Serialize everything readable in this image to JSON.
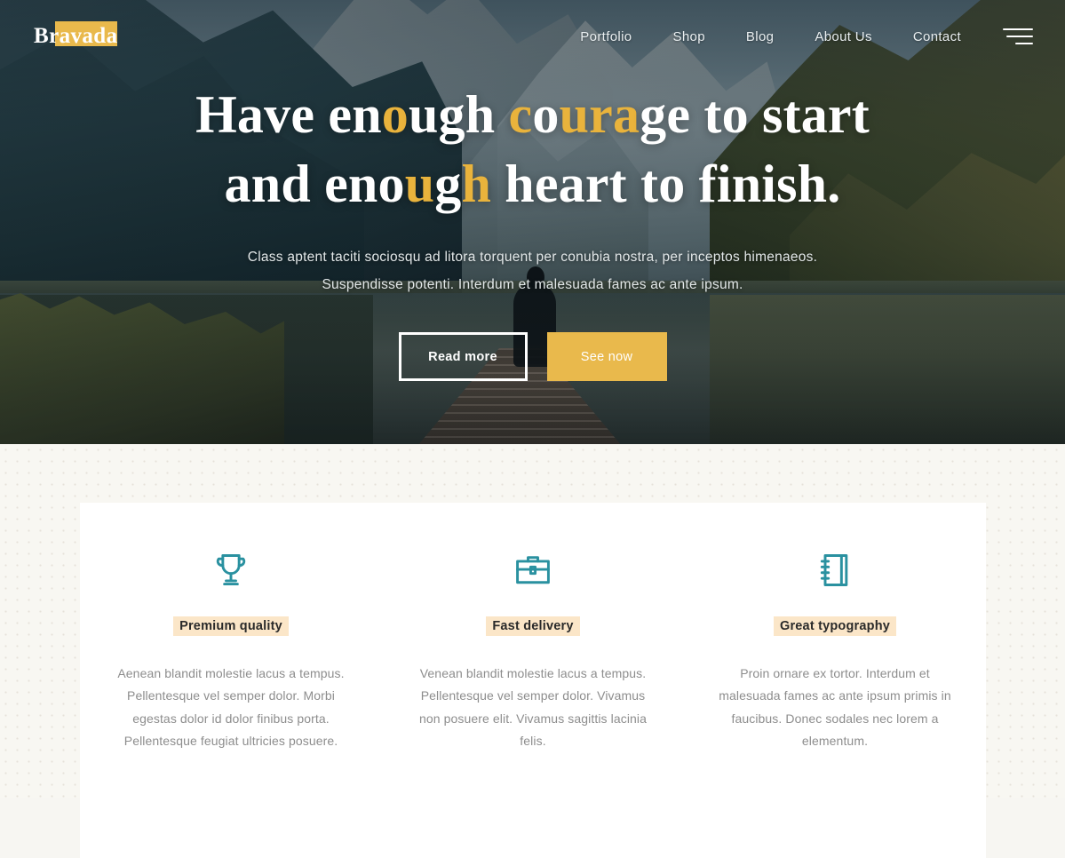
{
  "brand": {
    "name": "Bravada",
    "highlight_color": "#e9b94c"
  },
  "nav": {
    "items": [
      {
        "label": "Portfolio"
      },
      {
        "label": "Shop"
      },
      {
        "label": "Blog"
      },
      {
        "label": "About Us"
      },
      {
        "label": "Contact"
      }
    ],
    "menu_icon": "hamburger-icon"
  },
  "hero": {
    "headline_line1_parts": [
      {
        "text": "Have en",
        "gold": false
      },
      {
        "text": "o",
        "gold": true
      },
      {
        "text": "ugh ",
        "gold": false
      },
      {
        "text": "c",
        "gold": true
      },
      {
        "text": "o",
        "gold": false
      },
      {
        "text": "ura",
        "gold": true
      },
      {
        "text": "ge to start",
        "gold": false
      }
    ],
    "headline_line2_parts": [
      {
        "text": "and eno",
        "gold": false
      },
      {
        "text": "u",
        "gold": true
      },
      {
        "text": "g",
        "gold": false
      },
      {
        "text": "h",
        "gold": true
      },
      {
        "text": " heart to finish.",
        "gold": false
      }
    ],
    "headline_plain": "Have enough courage to start and enough heart to finish.",
    "subtitle": "Class aptent taciti sociosqu ad litora torquent per conubia nostra, per inceptos himenaeos. Suspendisse potenti. Interdum et malesuada fames ac ante ipsum.",
    "buttons": {
      "secondary_label": "Read more",
      "primary_label": "See now",
      "primary_color": "#e9b94c"
    },
    "background_scene": "lake-mountain-dock-photo"
  },
  "features": {
    "accent_color": "#2a91a0",
    "title_highlight_color": "#fbe6c8",
    "items": [
      {
        "icon": "trophy-icon",
        "title": "Premium quality",
        "text": "Aenean blandit molestie lacus a tempus. Pellentesque vel semper dolor. Morbi egestas dolor id dolor finibus porta. Pellentesque feugiat ultricies posuere."
      },
      {
        "icon": "briefcase-icon",
        "title": "Fast delivery",
        "text": "Venean blandit molestie lacus a tempus. Pellentesque vel semper dolor. Vivamus non posuere elit. Vivamus sagittis lacinia felis."
      },
      {
        "icon": "notebook-icon",
        "title": "Great typography",
        "text": "Proin ornare ex tortor. Interdum et malesuada fames ac ante ipsum primis in faucibus. Donec sodales nec lorem a elementum."
      }
    ]
  }
}
